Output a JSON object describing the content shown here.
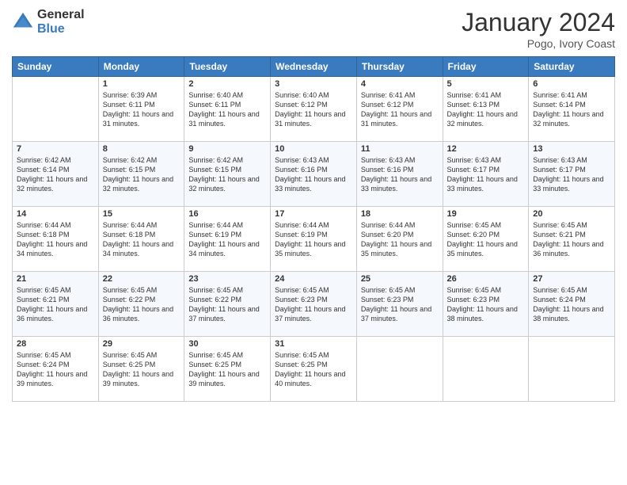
{
  "header": {
    "logo_general": "General",
    "logo_blue": "Blue",
    "title": "January 2024",
    "subtitle": "Pogo, Ivory Coast"
  },
  "days_of_week": [
    "Sunday",
    "Monday",
    "Tuesday",
    "Wednesday",
    "Thursday",
    "Friday",
    "Saturday"
  ],
  "weeks": [
    [
      {
        "day": "",
        "sunrise": "",
        "sunset": "",
        "daylight": ""
      },
      {
        "day": "1",
        "sunrise": "Sunrise: 6:39 AM",
        "sunset": "Sunset: 6:11 PM",
        "daylight": "Daylight: 11 hours and 31 minutes."
      },
      {
        "day": "2",
        "sunrise": "Sunrise: 6:40 AM",
        "sunset": "Sunset: 6:11 PM",
        "daylight": "Daylight: 11 hours and 31 minutes."
      },
      {
        "day": "3",
        "sunrise": "Sunrise: 6:40 AM",
        "sunset": "Sunset: 6:12 PM",
        "daylight": "Daylight: 11 hours and 31 minutes."
      },
      {
        "day": "4",
        "sunrise": "Sunrise: 6:41 AM",
        "sunset": "Sunset: 6:12 PM",
        "daylight": "Daylight: 11 hours and 31 minutes."
      },
      {
        "day": "5",
        "sunrise": "Sunrise: 6:41 AM",
        "sunset": "Sunset: 6:13 PM",
        "daylight": "Daylight: 11 hours and 32 minutes."
      },
      {
        "day": "6",
        "sunrise": "Sunrise: 6:41 AM",
        "sunset": "Sunset: 6:14 PM",
        "daylight": "Daylight: 11 hours and 32 minutes."
      }
    ],
    [
      {
        "day": "7",
        "sunrise": "Sunrise: 6:42 AM",
        "sunset": "Sunset: 6:14 PM",
        "daylight": "Daylight: 11 hours and 32 minutes."
      },
      {
        "day": "8",
        "sunrise": "Sunrise: 6:42 AM",
        "sunset": "Sunset: 6:15 PM",
        "daylight": "Daylight: 11 hours and 32 minutes."
      },
      {
        "day": "9",
        "sunrise": "Sunrise: 6:42 AM",
        "sunset": "Sunset: 6:15 PM",
        "daylight": "Daylight: 11 hours and 32 minutes."
      },
      {
        "day": "10",
        "sunrise": "Sunrise: 6:43 AM",
        "sunset": "Sunset: 6:16 PM",
        "daylight": "Daylight: 11 hours and 33 minutes."
      },
      {
        "day": "11",
        "sunrise": "Sunrise: 6:43 AM",
        "sunset": "Sunset: 6:16 PM",
        "daylight": "Daylight: 11 hours and 33 minutes."
      },
      {
        "day": "12",
        "sunrise": "Sunrise: 6:43 AM",
        "sunset": "Sunset: 6:17 PM",
        "daylight": "Daylight: 11 hours and 33 minutes."
      },
      {
        "day": "13",
        "sunrise": "Sunrise: 6:43 AM",
        "sunset": "Sunset: 6:17 PM",
        "daylight": "Daylight: 11 hours and 33 minutes."
      }
    ],
    [
      {
        "day": "14",
        "sunrise": "Sunrise: 6:44 AM",
        "sunset": "Sunset: 6:18 PM",
        "daylight": "Daylight: 11 hours and 34 minutes."
      },
      {
        "day": "15",
        "sunrise": "Sunrise: 6:44 AM",
        "sunset": "Sunset: 6:18 PM",
        "daylight": "Daylight: 11 hours and 34 minutes."
      },
      {
        "day": "16",
        "sunrise": "Sunrise: 6:44 AM",
        "sunset": "Sunset: 6:19 PM",
        "daylight": "Daylight: 11 hours and 34 minutes."
      },
      {
        "day": "17",
        "sunrise": "Sunrise: 6:44 AM",
        "sunset": "Sunset: 6:19 PM",
        "daylight": "Daylight: 11 hours and 35 minutes."
      },
      {
        "day": "18",
        "sunrise": "Sunrise: 6:44 AM",
        "sunset": "Sunset: 6:20 PM",
        "daylight": "Daylight: 11 hours and 35 minutes."
      },
      {
        "day": "19",
        "sunrise": "Sunrise: 6:45 AM",
        "sunset": "Sunset: 6:20 PM",
        "daylight": "Daylight: 11 hours and 35 minutes."
      },
      {
        "day": "20",
        "sunrise": "Sunrise: 6:45 AM",
        "sunset": "Sunset: 6:21 PM",
        "daylight": "Daylight: 11 hours and 36 minutes."
      }
    ],
    [
      {
        "day": "21",
        "sunrise": "Sunrise: 6:45 AM",
        "sunset": "Sunset: 6:21 PM",
        "daylight": "Daylight: 11 hours and 36 minutes."
      },
      {
        "day": "22",
        "sunrise": "Sunrise: 6:45 AM",
        "sunset": "Sunset: 6:22 PM",
        "daylight": "Daylight: 11 hours and 36 minutes."
      },
      {
        "day": "23",
        "sunrise": "Sunrise: 6:45 AM",
        "sunset": "Sunset: 6:22 PM",
        "daylight": "Daylight: 11 hours and 37 minutes."
      },
      {
        "day": "24",
        "sunrise": "Sunrise: 6:45 AM",
        "sunset": "Sunset: 6:23 PM",
        "daylight": "Daylight: 11 hours and 37 minutes."
      },
      {
        "day": "25",
        "sunrise": "Sunrise: 6:45 AM",
        "sunset": "Sunset: 6:23 PM",
        "daylight": "Daylight: 11 hours and 37 minutes."
      },
      {
        "day": "26",
        "sunrise": "Sunrise: 6:45 AM",
        "sunset": "Sunset: 6:23 PM",
        "daylight": "Daylight: 11 hours and 38 minutes."
      },
      {
        "day": "27",
        "sunrise": "Sunrise: 6:45 AM",
        "sunset": "Sunset: 6:24 PM",
        "daylight": "Daylight: 11 hours and 38 minutes."
      }
    ],
    [
      {
        "day": "28",
        "sunrise": "Sunrise: 6:45 AM",
        "sunset": "Sunset: 6:24 PM",
        "daylight": "Daylight: 11 hours and 39 minutes."
      },
      {
        "day": "29",
        "sunrise": "Sunrise: 6:45 AM",
        "sunset": "Sunset: 6:25 PM",
        "daylight": "Daylight: 11 hours and 39 minutes."
      },
      {
        "day": "30",
        "sunrise": "Sunrise: 6:45 AM",
        "sunset": "Sunset: 6:25 PM",
        "daylight": "Daylight: 11 hours and 39 minutes."
      },
      {
        "day": "31",
        "sunrise": "Sunrise: 6:45 AM",
        "sunset": "Sunset: 6:25 PM",
        "daylight": "Daylight: 11 hours and 40 minutes."
      },
      {
        "day": "",
        "sunrise": "",
        "sunset": "",
        "daylight": ""
      },
      {
        "day": "",
        "sunrise": "",
        "sunset": "",
        "daylight": ""
      },
      {
        "day": "",
        "sunrise": "",
        "sunset": "",
        "daylight": ""
      }
    ]
  ]
}
